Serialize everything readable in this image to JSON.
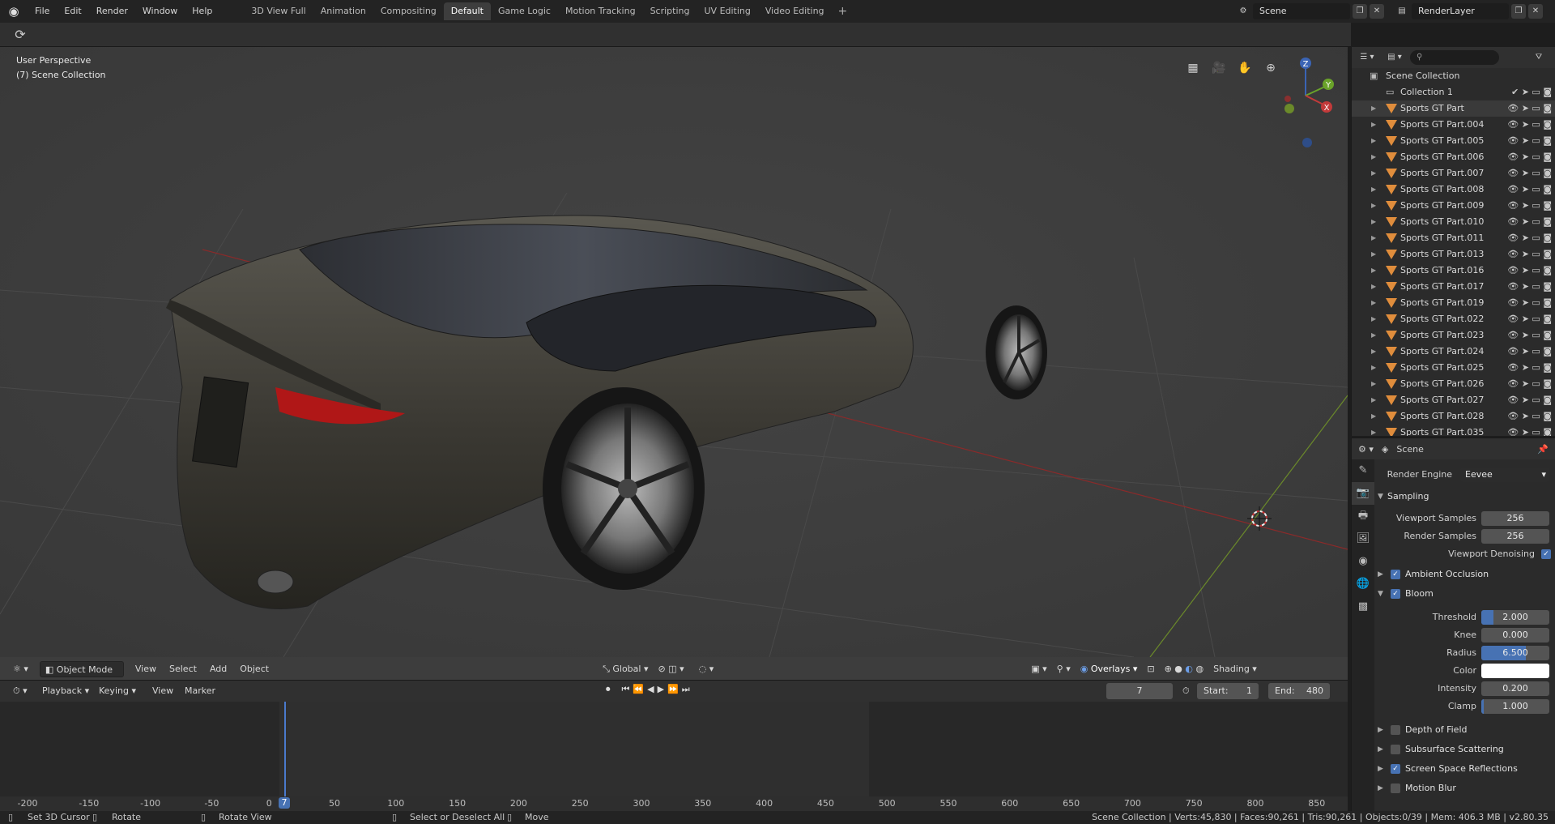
{
  "menu": [
    "File",
    "Edit",
    "Render",
    "Window",
    "Help"
  ],
  "workspace_tabs": [
    "3D View Full",
    "Animation",
    "Compositing",
    "Default",
    "Game Logic",
    "Motion Tracking",
    "Scripting",
    "UV Editing",
    "Video Editing"
  ],
  "active_workspace": "Default",
  "scene_name": "Scene",
  "render_layer": "RenderLayer",
  "viewport": {
    "view_name": "User Perspective",
    "collection_info": "(7) Scene Collection",
    "mode": "Object Mode",
    "menus": [
      "View",
      "Select",
      "Add",
      "Object"
    ],
    "transform_orientation": "Global",
    "overlays_label": "Overlays",
    "shading_label": "Shading",
    "gizmo": {
      "z": "Z",
      "y": "Y",
      "x": "X"
    }
  },
  "timeline": {
    "menus": [
      "Playback",
      "Keying",
      "View",
      "Marker"
    ],
    "current_frame": "7",
    "start_label": "Start:",
    "start": "1",
    "end_label": "End:",
    "end": "480",
    "ruler_ticks": [
      "-200",
      "-150",
      "-100",
      "-50",
      "0",
      "50",
      "100",
      "150",
      "200",
      "250",
      "300",
      "350",
      "400",
      "450",
      "500",
      "550",
      "600",
      "650",
      "700",
      "750",
      "800",
      "850"
    ],
    "playhead_label": "7"
  },
  "status": {
    "set_cursor": "Set 3D Cursor",
    "rotate": "Rotate",
    "rotate_view": "Rotate View",
    "select_all": "Select or Deselect All",
    "move": "Move",
    "stats": "Scene Collection | Verts:45,830 | Faces:90,261 | Tris:90,261 | Objects:0/39 | Mem: 406.3 MB | v2.80.35"
  },
  "outliner": {
    "root": "Scene Collection",
    "collection": "Collection 1",
    "items": [
      "Sports GT Part",
      "Sports GT Part.004",
      "Sports GT Part.005",
      "Sports GT Part.006",
      "Sports GT Part.007",
      "Sports GT Part.008",
      "Sports GT Part.009",
      "Sports GT Part.010",
      "Sports GT Part.011",
      "Sports GT Part.013",
      "Sports GT Part.016",
      "Sports GT Part.017",
      "Sports GT Part.019",
      "Sports GT Part.022",
      "Sports GT Part.023",
      "Sports GT Part.024",
      "Sports GT Part.025",
      "Sports GT Part.026",
      "Sports GT Part.027",
      "Sports GT Part.028",
      "Sports GT Part.035"
    ]
  },
  "properties": {
    "context": "Scene",
    "render_engine_label": "Render Engine",
    "render_engine": "Eevee",
    "sampling": "Sampling",
    "viewport_samples_label": "Viewport Samples",
    "viewport_samples": "256",
    "render_samples_label": "Render Samples",
    "render_samples": "256",
    "viewport_denoising": "Viewport Denoising",
    "ambient_occlusion": "Ambient Occlusion",
    "bloom": "Bloom",
    "threshold_label": "Threshold",
    "threshold": "2.000",
    "knee_label": "Knee",
    "knee": "0.000",
    "radius_label": "Radius",
    "radius": "6.500",
    "color_label": "Color",
    "intensity_label": "Intensity",
    "intensity": "0.200",
    "clamp_label": "Clamp",
    "clamp": "1.000",
    "depth_of_field": "Depth of Field",
    "subsurface_scattering": "Subsurface Scattering",
    "screen_space_reflections": "Screen Space Reflections",
    "motion_blur": "Motion Blur"
  },
  "colors": {
    "accent": "#4772b3",
    "object_icon": "#e08d3c",
    "viewport_bg": "#3d3d3d"
  }
}
